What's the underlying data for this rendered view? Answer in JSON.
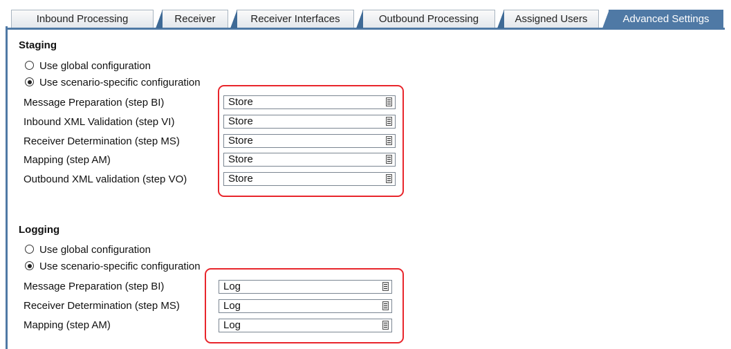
{
  "tabs": [
    {
      "label": "Inbound Processing",
      "active": false
    },
    {
      "label": "Receiver",
      "active": false
    },
    {
      "label": "Receiver Interfaces",
      "active": false
    },
    {
      "label": "Outbound Processing",
      "active": false
    },
    {
      "label": "Assigned Users",
      "active": false
    },
    {
      "label": "Advanced Settings",
      "active": true
    }
  ],
  "staging": {
    "title": "Staging",
    "radio_global": "Use global configuration",
    "radio_specific": "Use scenario-specific configuration",
    "selected": "specific",
    "fields": [
      {
        "label": "Message Preparation (step BI)",
        "value": "Store"
      },
      {
        "label": "Inbound XML Validation (step VI)",
        "value": "Store"
      },
      {
        "label": "Receiver Determination (step MS)",
        "value": "Store"
      },
      {
        "label": "Mapping (step AM)",
        "value": "Store"
      },
      {
        "label": "Outbound XML validation (step VO)",
        "value": "Store"
      }
    ]
  },
  "logging": {
    "title": "Logging",
    "radio_global": "Use global configuration",
    "radio_specific": "Use scenario-specific configuration",
    "selected": "specific",
    "fields": [
      {
        "label": "Message Preparation (step BI)",
        "value": "Log"
      },
      {
        "label": "Receiver Determination (step MS)",
        "value": "Log"
      },
      {
        "label": "Mapping (step AM)",
        "value": "Log"
      }
    ]
  },
  "colors": {
    "accent": "#4f79a5",
    "highlight": "#e8252b"
  }
}
